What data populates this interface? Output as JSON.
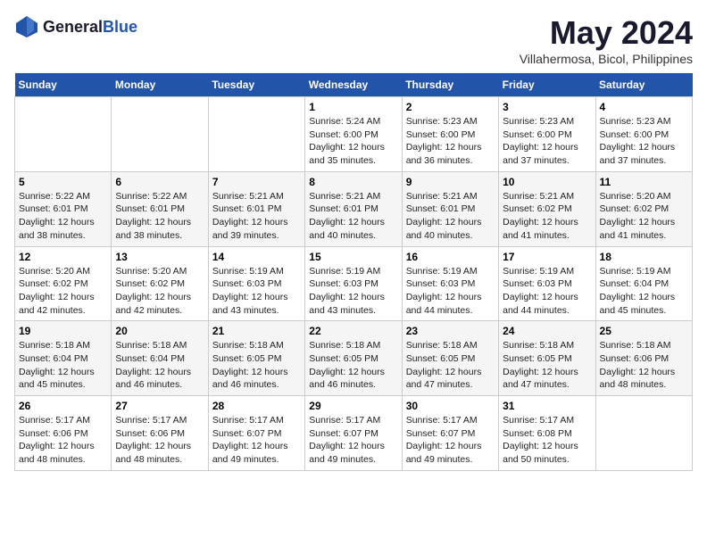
{
  "header": {
    "logo": {
      "text_general": "General",
      "text_blue": "Blue"
    },
    "title": "May 2024",
    "location": "Villahermosa, Bicol, Philippines"
  },
  "weekdays": [
    "Sunday",
    "Monday",
    "Tuesday",
    "Wednesday",
    "Thursday",
    "Friday",
    "Saturday"
  ],
  "weeks": [
    [
      {
        "day": "",
        "sunrise": "",
        "sunset": "",
        "daylight": ""
      },
      {
        "day": "",
        "sunrise": "",
        "sunset": "",
        "daylight": ""
      },
      {
        "day": "",
        "sunrise": "",
        "sunset": "",
        "daylight": ""
      },
      {
        "day": "1",
        "sunrise": "Sunrise: 5:24 AM",
        "sunset": "Sunset: 6:00 PM",
        "daylight": "Daylight: 12 hours and 35 minutes."
      },
      {
        "day": "2",
        "sunrise": "Sunrise: 5:23 AM",
        "sunset": "Sunset: 6:00 PM",
        "daylight": "Daylight: 12 hours and 36 minutes."
      },
      {
        "day": "3",
        "sunrise": "Sunrise: 5:23 AM",
        "sunset": "Sunset: 6:00 PM",
        "daylight": "Daylight: 12 hours and 37 minutes."
      },
      {
        "day": "4",
        "sunrise": "Sunrise: 5:23 AM",
        "sunset": "Sunset: 6:00 PM",
        "daylight": "Daylight: 12 hours and 37 minutes."
      }
    ],
    [
      {
        "day": "5",
        "sunrise": "Sunrise: 5:22 AM",
        "sunset": "Sunset: 6:01 PM",
        "daylight": "Daylight: 12 hours and 38 minutes."
      },
      {
        "day": "6",
        "sunrise": "Sunrise: 5:22 AM",
        "sunset": "Sunset: 6:01 PM",
        "daylight": "Daylight: 12 hours and 38 minutes."
      },
      {
        "day": "7",
        "sunrise": "Sunrise: 5:21 AM",
        "sunset": "Sunset: 6:01 PM",
        "daylight": "Daylight: 12 hours and 39 minutes."
      },
      {
        "day": "8",
        "sunrise": "Sunrise: 5:21 AM",
        "sunset": "Sunset: 6:01 PM",
        "daylight": "Daylight: 12 hours and 40 minutes."
      },
      {
        "day": "9",
        "sunrise": "Sunrise: 5:21 AM",
        "sunset": "Sunset: 6:01 PM",
        "daylight": "Daylight: 12 hours and 40 minutes."
      },
      {
        "day": "10",
        "sunrise": "Sunrise: 5:21 AM",
        "sunset": "Sunset: 6:02 PM",
        "daylight": "Daylight: 12 hours and 41 minutes."
      },
      {
        "day": "11",
        "sunrise": "Sunrise: 5:20 AM",
        "sunset": "Sunset: 6:02 PM",
        "daylight": "Daylight: 12 hours and 41 minutes."
      }
    ],
    [
      {
        "day": "12",
        "sunrise": "Sunrise: 5:20 AM",
        "sunset": "Sunset: 6:02 PM",
        "daylight": "Daylight: 12 hours and 42 minutes."
      },
      {
        "day": "13",
        "sunrise": "Sunrise: 5:20 AM",
        "sunset": "Sunset: 6:02 PM",
        "daylight": "Daylight: 12 hours and 42 minutes."
      },
      {
        "day": "14",
        "sunrise": "Sunrise: 5:19 AM",
        "sunset": "Sunset: 6:03 PM",
        "daylight": "Daylight: 12 hours and 43 minutes."
      },
      {
        "day": "15",
        "sunrise": "Sunrise: 5:19 AM",
        "sunset": "Sunset: 6:03 PM",
        "daylight": "Daylight: 12 hours and 43 minutes."
      },
      {
        "day": "16",
        "sunrise": "Sunrise: 5:19 AM",
        "sunset": "Sunset: 6:03 PM",
        "daylight": "Daylight: 12 hours and 44 minutes."
      },
      {
        "day": "17",
        "sunrise": "Sunrise: 5:19 AM",
        "sunset": "Sunset: 6:03 PM",
        "daylight": "Daylight: 12 hours and 44 minutes."
      },
      {
        "day": "18",
        "sunrise": "Sunrise: 5:19 AM",
        "sunset": "Sunset: 6:04 PM",
        "daylight": "Daylight: 12 hours and 45 minutes."
      }
    ],
    [
      {
        "day": "19",
        "sunrise": "Sunrise: 5:18 AM",
        "sunset": "Sunset: 6:04 PM",
        "daylight": "Daylight: 12 hours and 45 minutes."
      },
      {
        "day": "20",
        "sunrise": "Sunrise: 5:18 AM",
        "sunset": "Sunset: 6:04 PM",
        "daylight": "Daylight: 12 hours and 46 minutes."
      },
      {
        "day": "21",
        "sunrise": "Sunrise: 5:18 AM",
        "sunset": "Sunset: 6:05 PM",
        "daylight": "Daylight: 12 hours and 46 minutes."
      },
      {
        "day": "22",
        "sunrise": "Sunrise: 5:18 AM",
        "sunset": "Sunset: 6:05 PM",
        "daylight": "Daylight: 12 hours and 46 minutes."
      },
      {
        "day": "23",
        "sunrise": "Sunrise: 5:18 AM",
        "sunset": "Sunset: 6:05 PM",
        "daylight": "Daylight: 12 hours and 47 minutes."
      },
      {
        "day": "24",
        "sunrise": "Sunrise: 5:18 AM",
        "sunset": "Sunset: 6:05 PM",
        "daylight": "Daylight: 12 hours and 47 minutes."
      },
      {
        "day": "25",
        "sunrise": "Sunrise: 5:18 AM",
        "sunset": "Sunset: 6:06 PM",
        "daylight": "Daylight: 12 hours and 48 minutes."
      }
    ],
    [
      {
        "day": "26",
        "sunrise": "Sunrise: 5:17 AM",
        "sunset": "Sunset: 6:06 PM",
        "daylight": "Daylight: 12 hours and 48 minutes."
      },
      {
        "day": "27",
        "sunrise": "Sunrise: 5:17 AM",
        "sunset": "Sunset: 6:06 PM",
        "daylight": "Daylight: 12 hours and 48 minutes."
      },
      {
        "day": "28",
        "sunrise": "Sunrise: 5:17 AM",
        "sunset": "Sunset: 6:07 PM",
        "daylight": "Daylight: 12 hours and 49 minutes."
      },
      {
        "day": "29",
        "sunrise": "Sunrise: 5:17 AM",
        "sunset": "Sunset: 6:07 PM",
        "daylight": "Daylight: 12 hours and 49 minutes."
      },
      {
        "day": "30",
        "sunrise": "Sunrise: 5:17 AM",
        "sunset": "Sunset: 6:07 PM",
        "daylight": "Daylight: 12 hours and 49 minutes."
      },
      {
        "day": "31",
        "sunrise": "Sunrise: 5:17 AM",
        "sunset": "Sunset: 6:08 PM",
        "daylight": "Daylight: 12 hours and 50 minutes."
      },
      {
        "day": "",
        "sunrise": "",
        "sunset": "",
        "daylight": ""
      }
    ]
  ]
}
